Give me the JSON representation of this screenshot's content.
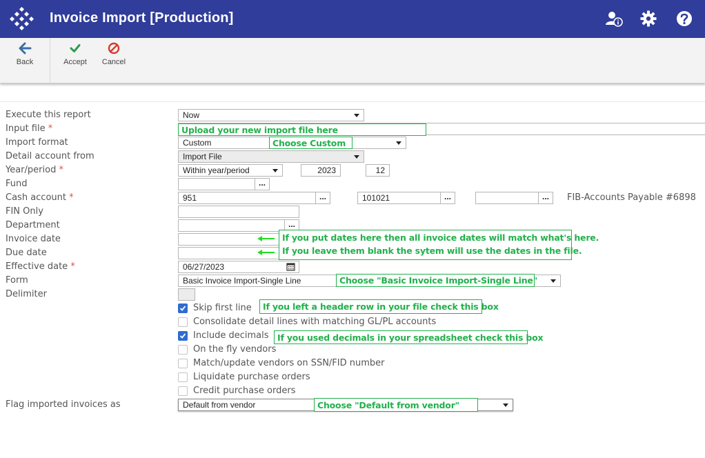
{
  "header": {
    "title": "Invoice Import [Production]",
    "icons": [
      "app-logo-icon",
      "user-info-icon",
      "gear-icon",
      "help-icon"
    ],
    "background": "#303d9a"
  },
  "toolbar": {
    "back_label": "Back",
    "accept_label": "Accept",
    "cancel_label": "Cancel"
  },
  "form": {
    "execute": {
      "label": "Execute this report",
      "value": "Now"
    },
    "input_file": {
      "label": "Input file",
      "required": "*",
      "value": ""
    },
    "import_format": {
      "label": "Import format",
      "value": "Custom"
    },
    "detail_account": {
      "label": "Detail account from",
      "value": "Import File"
    },
    "year_period": {
      "label": "Year/period",
      "required": "*",
      "value": "Within year/period",
      "year": "2023",
      "period": "12"
    },
    "fund": {
      "label": "Fund",
      "value": "",
      "lookup": "..."
    },
    "cash_account": {
      "label": "Cash account",
      "required": "*",
      "part1": "951",
      "part2": "101021",
      "part3": "",
      "lookup": "...",
      "description": "FIB-Accounts Payable #6898"
    },
    "fin_only": {
      "label": "FIN Only",
      "value": ""
    },
    "department": {
      "label": "Department",
      "value": "",
      "lookup": "..."
    },
    "invoice_date": {
      "label": "Invoice date",
      "value": ""
    },
    "due_date": {
      "label": "Due date",
      "value": ""
    },
    "effective_date": {
      "label": "Effective date",
      "required": "*",
      "value": "06/27/2023"
    },
    "form": {
      "label": "Form",
      "value": "Basic Invoice Import-Single Line"
    },
    "delimiter": {
      "label": "Delimiter",
      "value": ""
    },
    "checkboxes": [
      {
        "label": "Skip first line",
        "checked": true
      },
      {
        "label": "Consolidate detail lines with matching GL/PL accounts",
        "checked": false
      },
      {
        "label": "Include decimals",
        "checked": true
      },
      {
        "label": "On the fly vendors",
        "checked": false
      },
      {
        "label": "Match/update vendors on SSN/FID number",
        "checked": false
      },
      {
        "label": "Liquidate purchase orders",
        "checked": false
      },
      {
        "label": "Credit purchase orders",
        "checked": false
      }
    ],
    "flag_imported": {
      "label": "Flag imported invoices as",
      "value": "Default from vendor"
    }
  },
  "annotations": {
    "upload": "Upload your new import file here",
    "custom": "Choose Custom",
    "dates_line1": "If you put dates here then all invoice dates will match what's here.",
    "dates_line2": "If you leave them blank the sytem will use the dates in the file.",
    "form_choice": "Choose \"Basic Invoice Import-Single Line\"",
    "header_row": "If you left a header row in your file check this box",
    "decimals": "If you used decimals in your spreadsheet check this box",
    "vendor": "Choose \"Default from vendor\"",
    "color": "#22b14c"
  }
}
